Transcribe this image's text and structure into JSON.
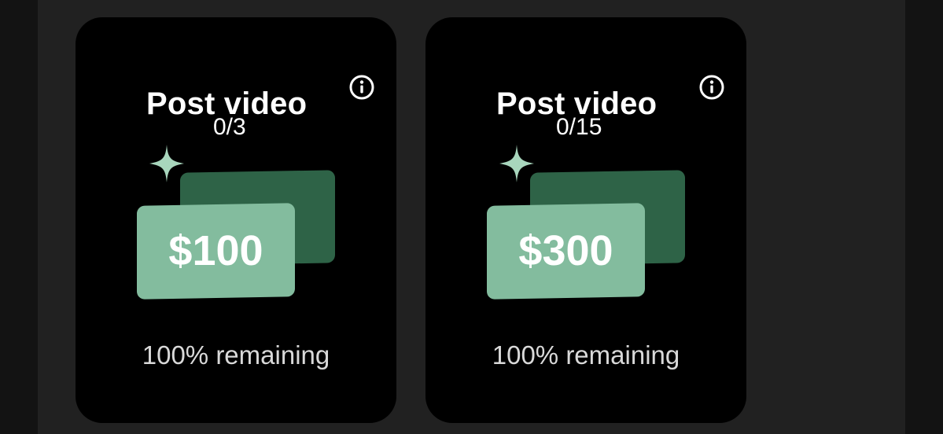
{
  "colors": {
    "background": "#131313",
    "panel": "#212121",
    "card": "#000000",
    "note_back": "#2e6347",
    "note_front": "#83bc9e",
    "sparkle": "#a8d6bd"
  },
  "cards": [
    {
      "title": "Post video",
      "progress": "0/3",
      "reward": "$100",
      "remaining": "100% remaining",
      "info_icon": "info-icon",
      "decor_icon": "sparkle-icon"
    },
    {
      "title": "Post video",
      "progress": "0/15",
      "reward": "$300",
      "remaining": "100% remaining",
      "info_icon": "info-icon",
      "decor_icon": "sparkle-icon"
    }
  ]
}
